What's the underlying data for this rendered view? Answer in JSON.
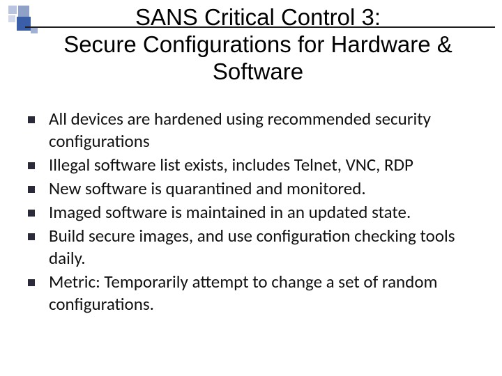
{
  "title": "SANS Critical Control 3:\nSecure Configurations for Hardware & Software",
  "bullets": [
    "All devices are hardened using recommended security configurations",
    "Illegal software list exists, includes Telnet, VNC, RDP",
    "New software is quarantined and monitored.",
    "Imaged software is maintained in an updated state.",
    "Build secure images, and use configuration checking tools daily.",
    "Metric: Temporarily attempt to change a set of random configurations."
  ]
}
